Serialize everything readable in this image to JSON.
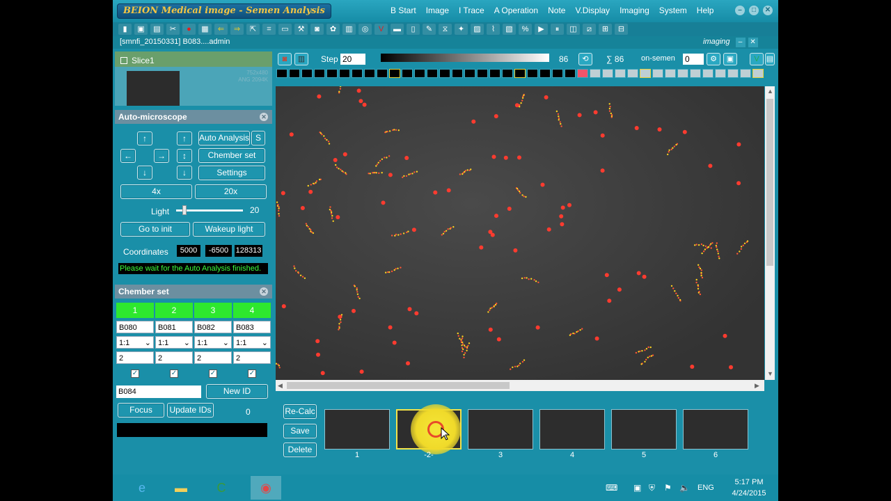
{
  "window": {
    "title": "BEION Medical image - Semen Analysis",
    "controls": [
      "–",
      "□",
      "✕"
    ]
  },
  "menu": [
    "B Start",
    "Image",
    "I Trace",
    "A Operation",
    "Note",
    "V.Display",
    "Imaging",
    "System",
    "Help"
  ],
  "pathbar": {
    "text": "[smnfi_20150331] B083....admin",
    "imaging_label": "imaging"
  },
  "slice": {
    "label": "Slice1",
    "info_line1": "752x480",
    "info_line2": "ANG 2094K"
  },
  "auto_microscope": {
    "title": "Auto-microscope",
    "arrow_up": "↑",
    "arrow_down": "↓",
    "arrow_left": "←",
    "arrow_right": "→",
    "arrow_updown": "↕",
    "auto_analysis": "Auto Analysis",
    "s_button": "S",
    "chamber_set": "Chember set",
    "settings": "Settings",
    "zoom_4x": "4x",
    "zoom_20x": "20x",
    "light_label": "Light",
    "light_value": "20",
    "light_level": 0.1,
    "go_to_init": "Go to init",
    "wakeup_light": "Wakeup light",
    "coordinates_label": "Coordinates",
    "coord_x": "5000",
    "coord_y": "-6500",
    "coord_z": "128313",
    "status": "Please wait for the Auto Analysis finished."
  },
  "chamber_set": {
    "title": "Chember set",
    "columns": [
      "1",
      "2",
      "3",
      "4"
    ],
    "ids": [
      "B080",
      "B081",
      "B082",
      "B083"
    ],
    "ratios": [
      "1:1",
      "1:1",
      "1:1",
      "1:1"
    ],
    "values": [
      "2",
      "2",
      "2",
      "2"
    ],
    "new_id_value": "B084",
    "new_id_button": "New ID",
    "focus_button": "Focus",
    "update_ids_button": "Update IDs",
    "count": "0"
  },
  "image_toolbar": {
    "step_label": "Step",
    "step_value": "20",
    "step_readout": "86",
    "sigma_label": "∑ 86",
    "non_semen_label": "on-semen",
    "non_semen_value": "0"
  },
  "actions": {
    "recalc": "Re-Calc",
    "save": "Save",
    "delete": "Delete"
  },
  "thumbnails": [
    "1",
    "-2-",
    "3",
    "4",
    "5",
    "6"
  ],
  "taskbar": {
    "lang": "ENG",
    "time": "5:17 PM",
    "date": "4/24/2015"
  },
  "colors": {
    "app_bg": "#1a8fa8",
    "chamber_header": "#2ee82e",
    "status_text": "#3cff3c",
    "highlight": "#f3e34a"
  }
}
